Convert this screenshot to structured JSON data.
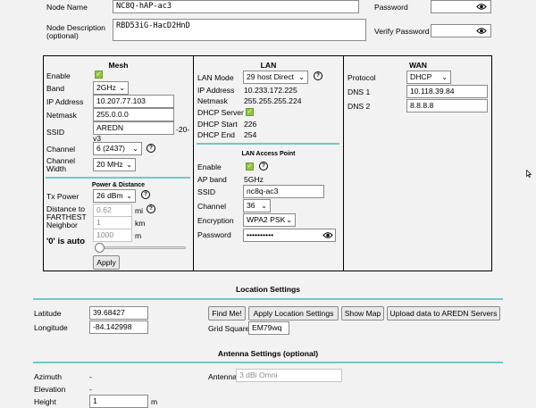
{
  "node": {
    "name_label": "Node Name",
    "name_value": "NC8Q-hAP-ac3",
    "desc_label_1": "Node Description",
    "desc_label_2": "(optional)",
    "desc_value": "RBD53iG-HacD2HnD",
    "password_label": "Password",
    "verify_label": "Verify Password"
  },
  "mesh": {
    "title": "Mesh",
    "enable_label": "Enable",
    "band_label": "Band",
    "band_value": "2GHz",
    "ip_label": "IP Address",
    "ip_value": "10.207.77.103",
    "netmask_label": "Netmask",
    "netmask_value": "255.0.0.0",
    "ssid_label": "SSID",
    "ssid_value": "AREDN",
    "ssid_suffix_1": "-20-",
    "ssid_suffix_2": "v3",
    "channel_label": "Channel",
    "channel_value": "6 (2437)",
    "width_label_1": "Channel",
    "width_label_2": "Width",
    "width_value": "20 MHz",
    "pd_title": "Power & Distance",
    "tx_label": "Tx Power",
    "tx_value": "26 dBm",
    "dist_label_1": "Distance to",
    "dist_label_2": "FARTHEST",
    "dist_label_3": "Neighbor",
    "dist_mi": "0.62",
    "dist_mi_unit": "mi",
    "dist_km": "1",
    "dist_km_unit": "km",
    "dist_m": "1000",
    "dist_m_unit": "m",
    "auto_note": "'0' is auto",
    "apply_label": "Apply"
  },
  "lan": {
    "title": "LAN",
    "mode_label": "LAN Mode",
    "mode_value": "29 host Direct",
    "ip_label": "IP Address",
    "ip_value": "10.233.172.225",
    "netmask_label": "Netmask",
    "netmask_value": "255.255.255.224",
    "dhcp_label": "DHCP Server",
    "dhcp_start_label": "DHCP Start",
    "dhcp_start_value": "226",
    "dhcp_end_label": "DHCP End",
    "dhcp_end_value": "254",
    "ap_title": "LAN Access Point",
    "ap_enable_label": "Enable",
    "ap_band_label": "AP band",
    "ap_band_value": "5GHz",
    "ap_ssid_label": "SSID",
    "ap_ssid_value": "nc8q-ac3",
    "ap_channel_label": "Channel",
    "ap_channel_value": "36",
    "encryption_label": "Encryption",
    "encryption_value": "WPA2 PSK",
    "ap_password_label": "Password",
    "ap_password_value": "••••••••••"
  },
  "wan": {
    "title": "WAN",
    "protocol_label": "Protocol",
    "protocol_value": "DHCP",
    "dns1_label": "DNS 1",
    "dns1_value": "10.118.39.84",
    "dns2_label": "DNS 2",
    "dns2_value": "8.8.8.8"
  },
  "location": {
    "title": "Location Settings",
    "lat_label": "Latitude",
    "lat_value": "39.68427",
    "lon_label": "Longitude",
    "lon_value": "-84.142998",
    "find_me": "Find Me!",
    "apply_location": "Apply Location Settings",
    "show_map": "Show Map",
    "upload": "Upload data to AREDN Servers",
    "grid_label": "Grid Square",
    "grid_value": "EM79wq"
  },
  "antenna": {
    "title": "Antenna Settings (optional)",
    "azimuth_label": "Azimuth",
    "azimuth_value": "-",
    "elevation_label": "Elevation",
    "elevation_value": "-",
    "height_label": "Height",
    "height_value": "1",
    "height_unit": "m",
    "antenna_label": "Antenna",
    "antenna_value": "3 dBi Omni"
  },
  "colors": {
    "accent_rule": "#6ec9c6",
    "checkbox": "#8fc73e"
  },
  "icons": [
    "eye-icon",
    "help-icon",
    "checkbox-checked-icon",
    "chevron-down-icon"
  ]
}
